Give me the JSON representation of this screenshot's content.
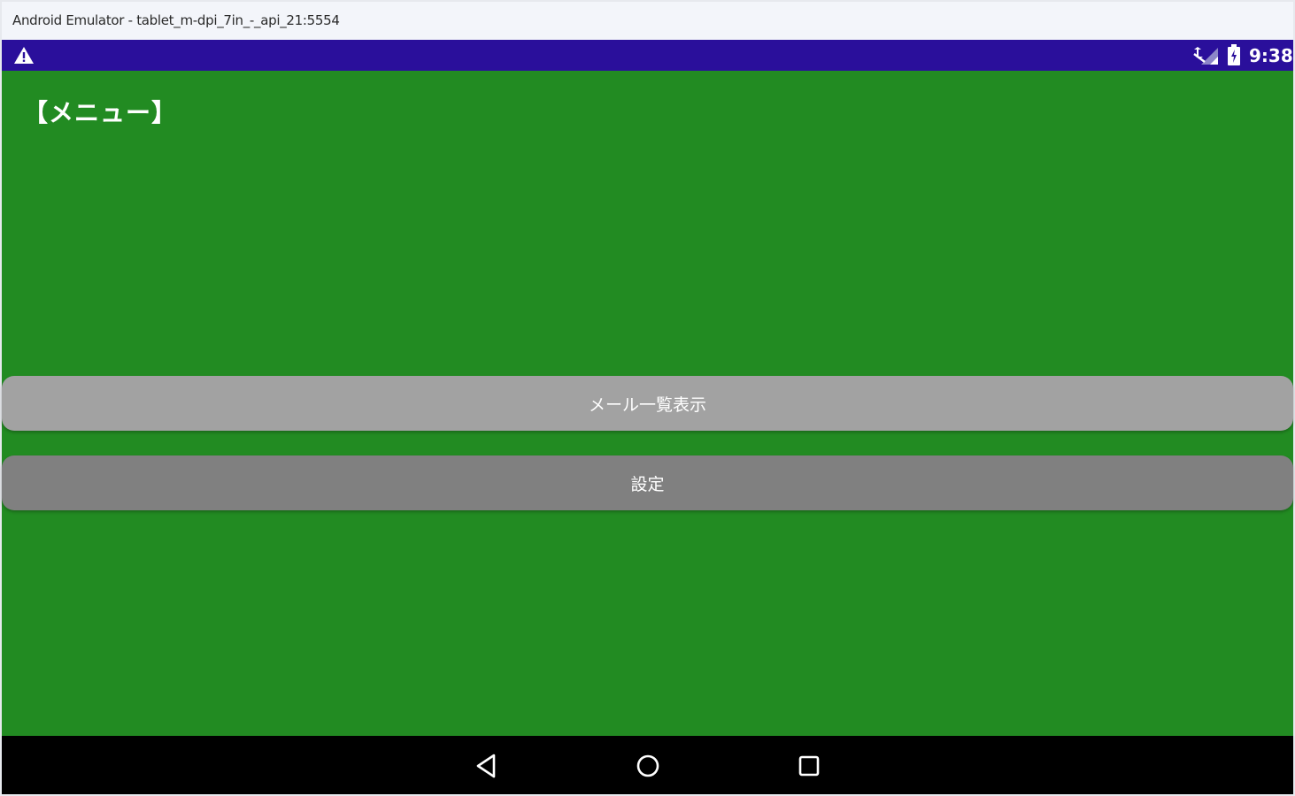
{
  "window": {
    "title": "Android Emulator - tablet_m-dpi_7in_-_api_21:5554"
  },
  "status_bar": {
    "time": "9:38",
    "background_color": "#2a0f9b",
    "icons": [
      "warning-icon",
      "signal-icon",
      "battery-icon"
    ]
  },
  "screen": {
    "title": "【メニュー】",
    "background_color": "#228b22",
    "buttons": [
      {
        "label": "メール一覧表示",
        "color": "#a2a2a2"
      },
      {
        "label": "設定",
        "color": "#808080"
      }
    ]
  },
  "nav_bar": {
    "icons": [
      "back-icon",
      "home-icon",
      "recents-icon"
    ]
  }
}
